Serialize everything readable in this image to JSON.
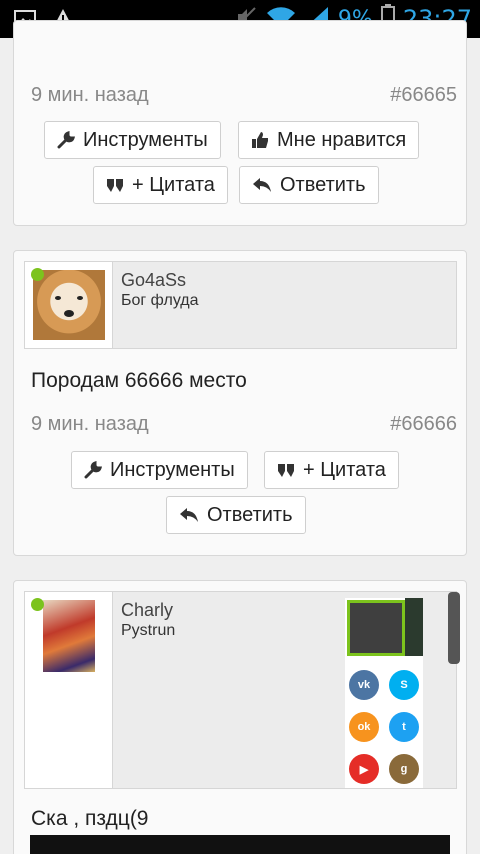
{
  "status_bar": {
    "battery": "9%",
    "time": "23:27"
  },
  "posts": [
    {
      "time": "9 мин. назад",
      "number": "#66665",
      "buttons": {
        "tools": "Инструменты",
        "like": "Мне нравится",
        "quote": "+ Цитата",
        "reply": "Ответить"
      }
    },
    {
      "username": "Go4aSs",
      "rank": "Бог флуда",
      "text": "Породам 66666 место",
      "time": "9 мин. назад",
      "number": "#66666",
      "buttons": {
        "tools": "Инструменты",
        "quote": "+ Цитата",
        "reply": "Ответить"
      }
    },
    {
      "username": "Charly",
      "rank": "Pystrun",
      "text": "Ска , пздц(9"
    }
  ],
  "colors": {
    "online": "#7cc31d",
    "status_accent": "#2fa6e5"
  }
}
